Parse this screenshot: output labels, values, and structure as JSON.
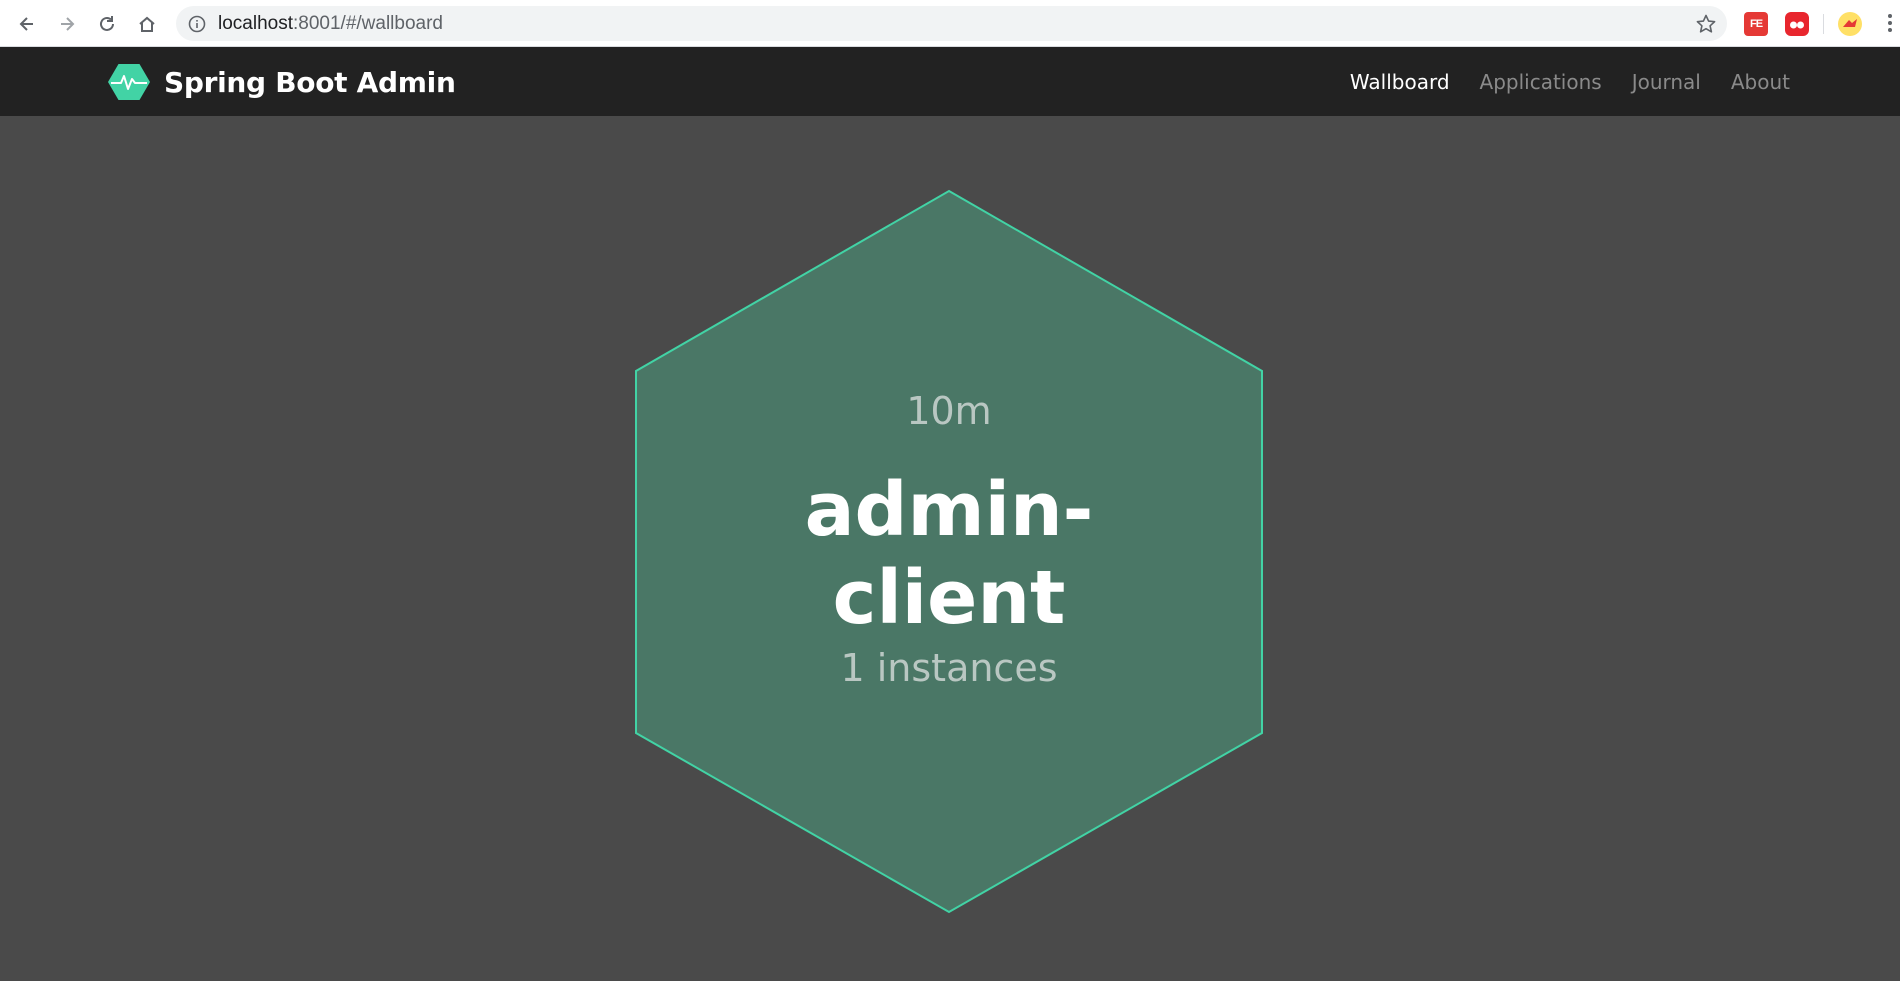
{
  "browser": {
    "url_host": "localhost",
    "url_rest": ":8001/#/wallboard",
    "icons": [
      "back-arrow-icon",
      "forward-arrow-icon",
      "reload-icon",
      "home-icon",
      "info-icon",
      "star-icon",
      "kebab-menu-icon"
    ],
    "extensions": [
      {
        "name": "fe-extension-icon",
        "label": "FE"
      },
      {
        "name": "red-extension-icon",
        "label": ""
      },
      {
        "name": "bird-extension-icon",
        "label": ""
      }
    ]
  },
  "navbar": {
    "brand_title": "Spring Boot Admin",
    "links": [
      {
        "label": "Wallboard",
        "active": true
      },
      {
        "label": "Applications",
        "active": false
      },
      {
        "label": "Journal",
        "active": false
      },
      {
        "label": "About",
        "active": false
      }
    ]
  },
  "wallboard": {
    "applications": [
      {
        "uptime": "10m",
        "name_line1": "admin-",
        "name_line2": "client",
        "instances": "1 instances",
        "status_color": "#42d3a5",
        "fill_color": "#4a7766"
      }
    ]
  },
  "colors": {
    "page_bg": "#4a4a4a",
    "navbar_bg": "#222222",
    "brand_accent": "#42d3a5",
    "nav_active": "#ffffff",
    "nav_inactive": "#8a8a8a"
  }
}
